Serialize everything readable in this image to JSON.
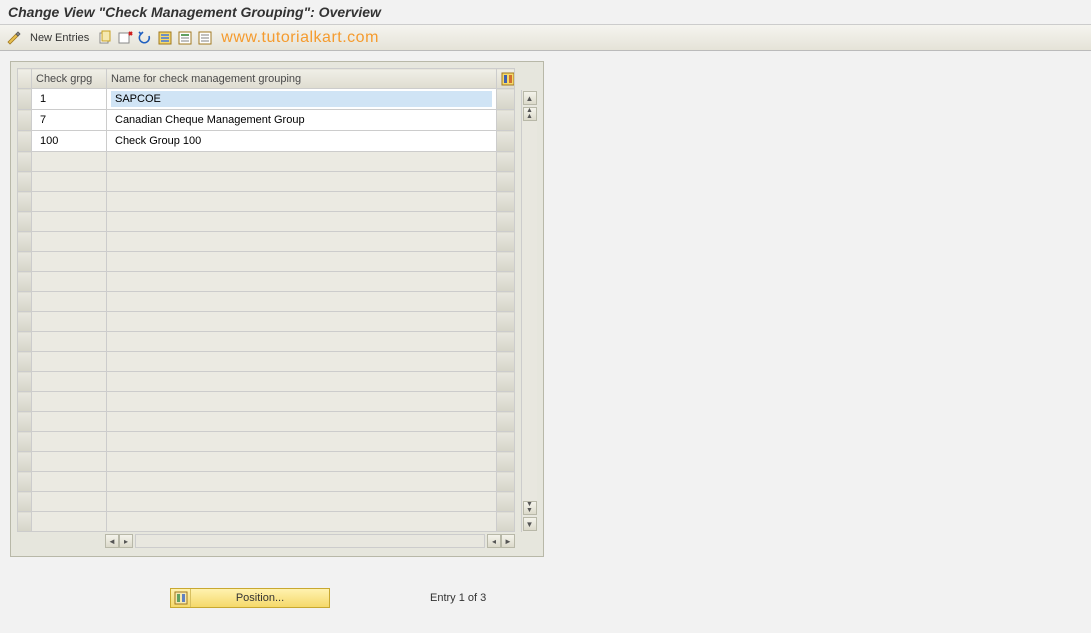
{
  "title": "Change View \"Check Management Grouping\": Overview",
  "toolbar": {
    "new_entries_label": "New Entries"
  },
  "watermark": "www.tutorialkart.com",
  "table": {
    "col1_header": "Check grpg",
    "col2_header": "Name for check management grouping",
    "rows": [
      {
        "grpg": "1",
        "name": "SAPCOE",
        "selected": true
      },
      {
        "grpg": "7",
        "name": "Canadian Cheque Management Group",
        "selected": false
      },
      {
        "grpg": "100",
        "name": "Check Group 100",
        "selected": false
      }
    ],
    "empty_row_count": 19
  },
  "footer": {
    "position_label": "Position...",
    "entry_text": "Entry 1 of 3"
  }
}
